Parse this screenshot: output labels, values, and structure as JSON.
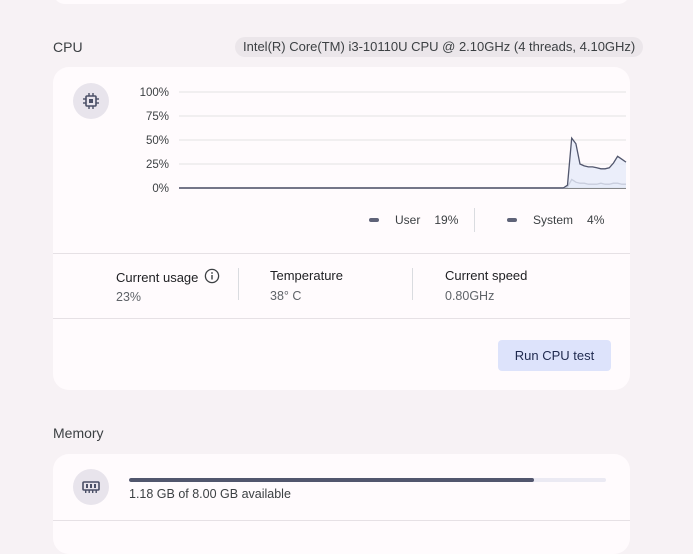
{
  "cpu": {
    "section_title": "CPU",
    "processor": "Intel(R) Core(TM) i3-10110U CPU @ 2.10GHz (4 threads, 4.10GHz)",
    "chart_data": {
      "type": "area",
      "y_ticks": [
        "100%",
        "75%",
        "50%",
        "25%",
        "0%"
      ],
      "ylim": [
        0,
        100
      ],
      "series": [
        {
          "name": "System",
          "values": [
            0,
            0,
            0,
            0,
            0,
            0,
            0,
            0,
            0,
            0,
            0,
            0,
            0,
            0,
            0,
            0,
            0,
            0,
            0,
            0,
            0,
            0,
            0,
            0,
            0,
            0,
            0,
            0,
            0,
            0,
            0,
            0,
            0,
            0,
            0,
            0,
            0,
            0,
            0,
            0,
            0,
            0,
            0,
            0,
            0,
            0,
            0,
            0,
            0,
            0,
            0,
            0,
            0,
            0,
            0,
            0,
            0,
            0,
            0,
            0,
            0,
            0,
            0,
            0,
            0,
            0,
            0,
            0,
            0,
            0,
            0,
            0,
            0,
            0,
            0,
            0,
            0,
            0,
            0,
            0,
            0,
            0,
            0,
            0,
            0,
            0,
            0,
            0,
            0,
            0,
            0,
            0,
            0,
            1,
            9,
            6,
            5,
            5,
            4,
            4,
            4,
            5,
            4,
            4,
            5,
            5,
            4,
            4
          ]
        },
        {
          "name": "User",
          "values": [
            0,
            0,
            0,
            0,
            0,
            0,
            0,
            0,
            0,
            0,
            0,
            0,
            0,
            0,
            0,
            0,
            0,
            0,
            0,
            0,
            0,
            0,
            0,
            0,
            0,
            0,
            0,
            0,
            0,
            0,
            0,
            0,
            0,
            0,
            0,
            0,
            0,
            0,
            0,
            0,
            0,
            0,
            0,
            0,
            0,
            0,
            0,
            0,
            0,
            0,
            0,
            0,
            0,
            0,
            0,
            0,
            0,
            0,
            0,
            0,
            0,
            0,
            0,
            0,
            0,
            0,
            0,
            0,
            0,
            0,
            0,
            0,
            0,
            0,
            0,
            0,
            0,
            0,
            0,
            0,
            0,
            0,
            0,
            0,
            0,
            0,
            0,
            0,
            0,
            0,
            0,
            0,
            0,
            3,
            52,
            46,
            25,
            23,
            22,
            22,
            21,
            20,
            20,
            21,
            26,
            33,
            30,
            27
          ]
        }
      ]
    },
    "legend": [
      {
        "label": "User",
        "value": "19%"
      },
      {
        "label": "System",
        "value": "4%"
      }
    ],
    "metrics": {
      "usage_label": "Current usage",
      "usage_value": "23%",
      "temperature_label": "Temperature",
      "temperature_value": "38° C",
      "speed_label": "Current speed",
      "speed_value": "0.80GHz"
    },
    "run_test_label": "Run CPU test",
    "colors": {
      "line": "#51566d",
      "fill": "#e6ebf9",
      "accent": "#dde3fb"
    }
  },
  "memory": {
    "section_title": "Memory",
    "usage_fraction": 0.85,
    "available_text": "1.18 GB of 8.00 GB available"
  }
}
